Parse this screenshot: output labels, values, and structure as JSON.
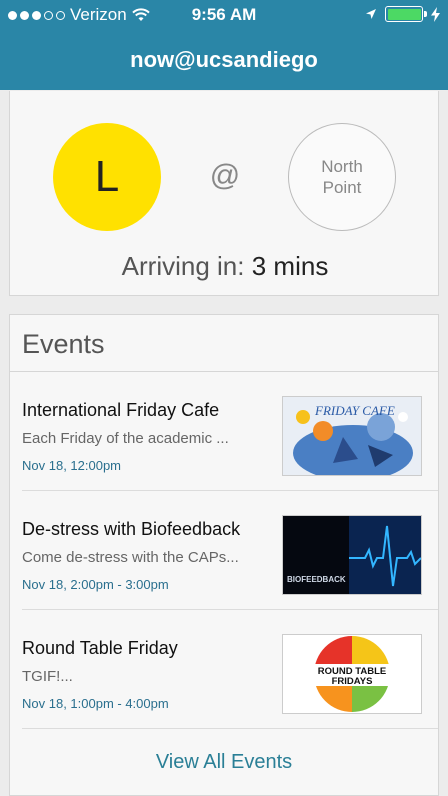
{
  "status_bar": {
    "carrier": "Verizon",
    "time": "9:56 AM",
    "battery_color": "#4cd964"
  },
  "nav": {
    "title": "now@ucsandiego"
  },
  "arrival": {
    "bus_letter": "L",
    "bus_color": "#ffe100",
    "at": "@",
    "stop_line1": "North",
    "stop_line2": "Point",
    "arriving_label": "Arriving in:",
    "arriving_value": "3 mins"
  },
  "events": {
    "title": "Events",
    "items": [
      {
        "title": "International Friday Cafe",
        "description": "Each Friday of the academic ...",
        "date": "Nov 18, 12:00pm",
        "thumb_text": "FRIDAY CAFE"
      },
      {
        "title": "De-stress with Biofeedback",
        "description": "Come de-stress with the CAPs...",
        "date": "Nov 18, 2:00pm - 3:00pm",
        "thumb_text": "BIOFEEDBACK"
      },
      {
        "title": "Round Table Friday",
        "description": "TGIF!...",
        "date": "Nov 18, 1:00pm - 4:00pm",
        "thumb_text_line1": "ROUND TABLE",
        "thumb_text_line2": "FRIDAYS"
      }
    ],
    "view_all": "View All Events"
  },
  "colors": {
    "brand": "#2a86a7",
    "link": "#2a7f96"
  }
}
